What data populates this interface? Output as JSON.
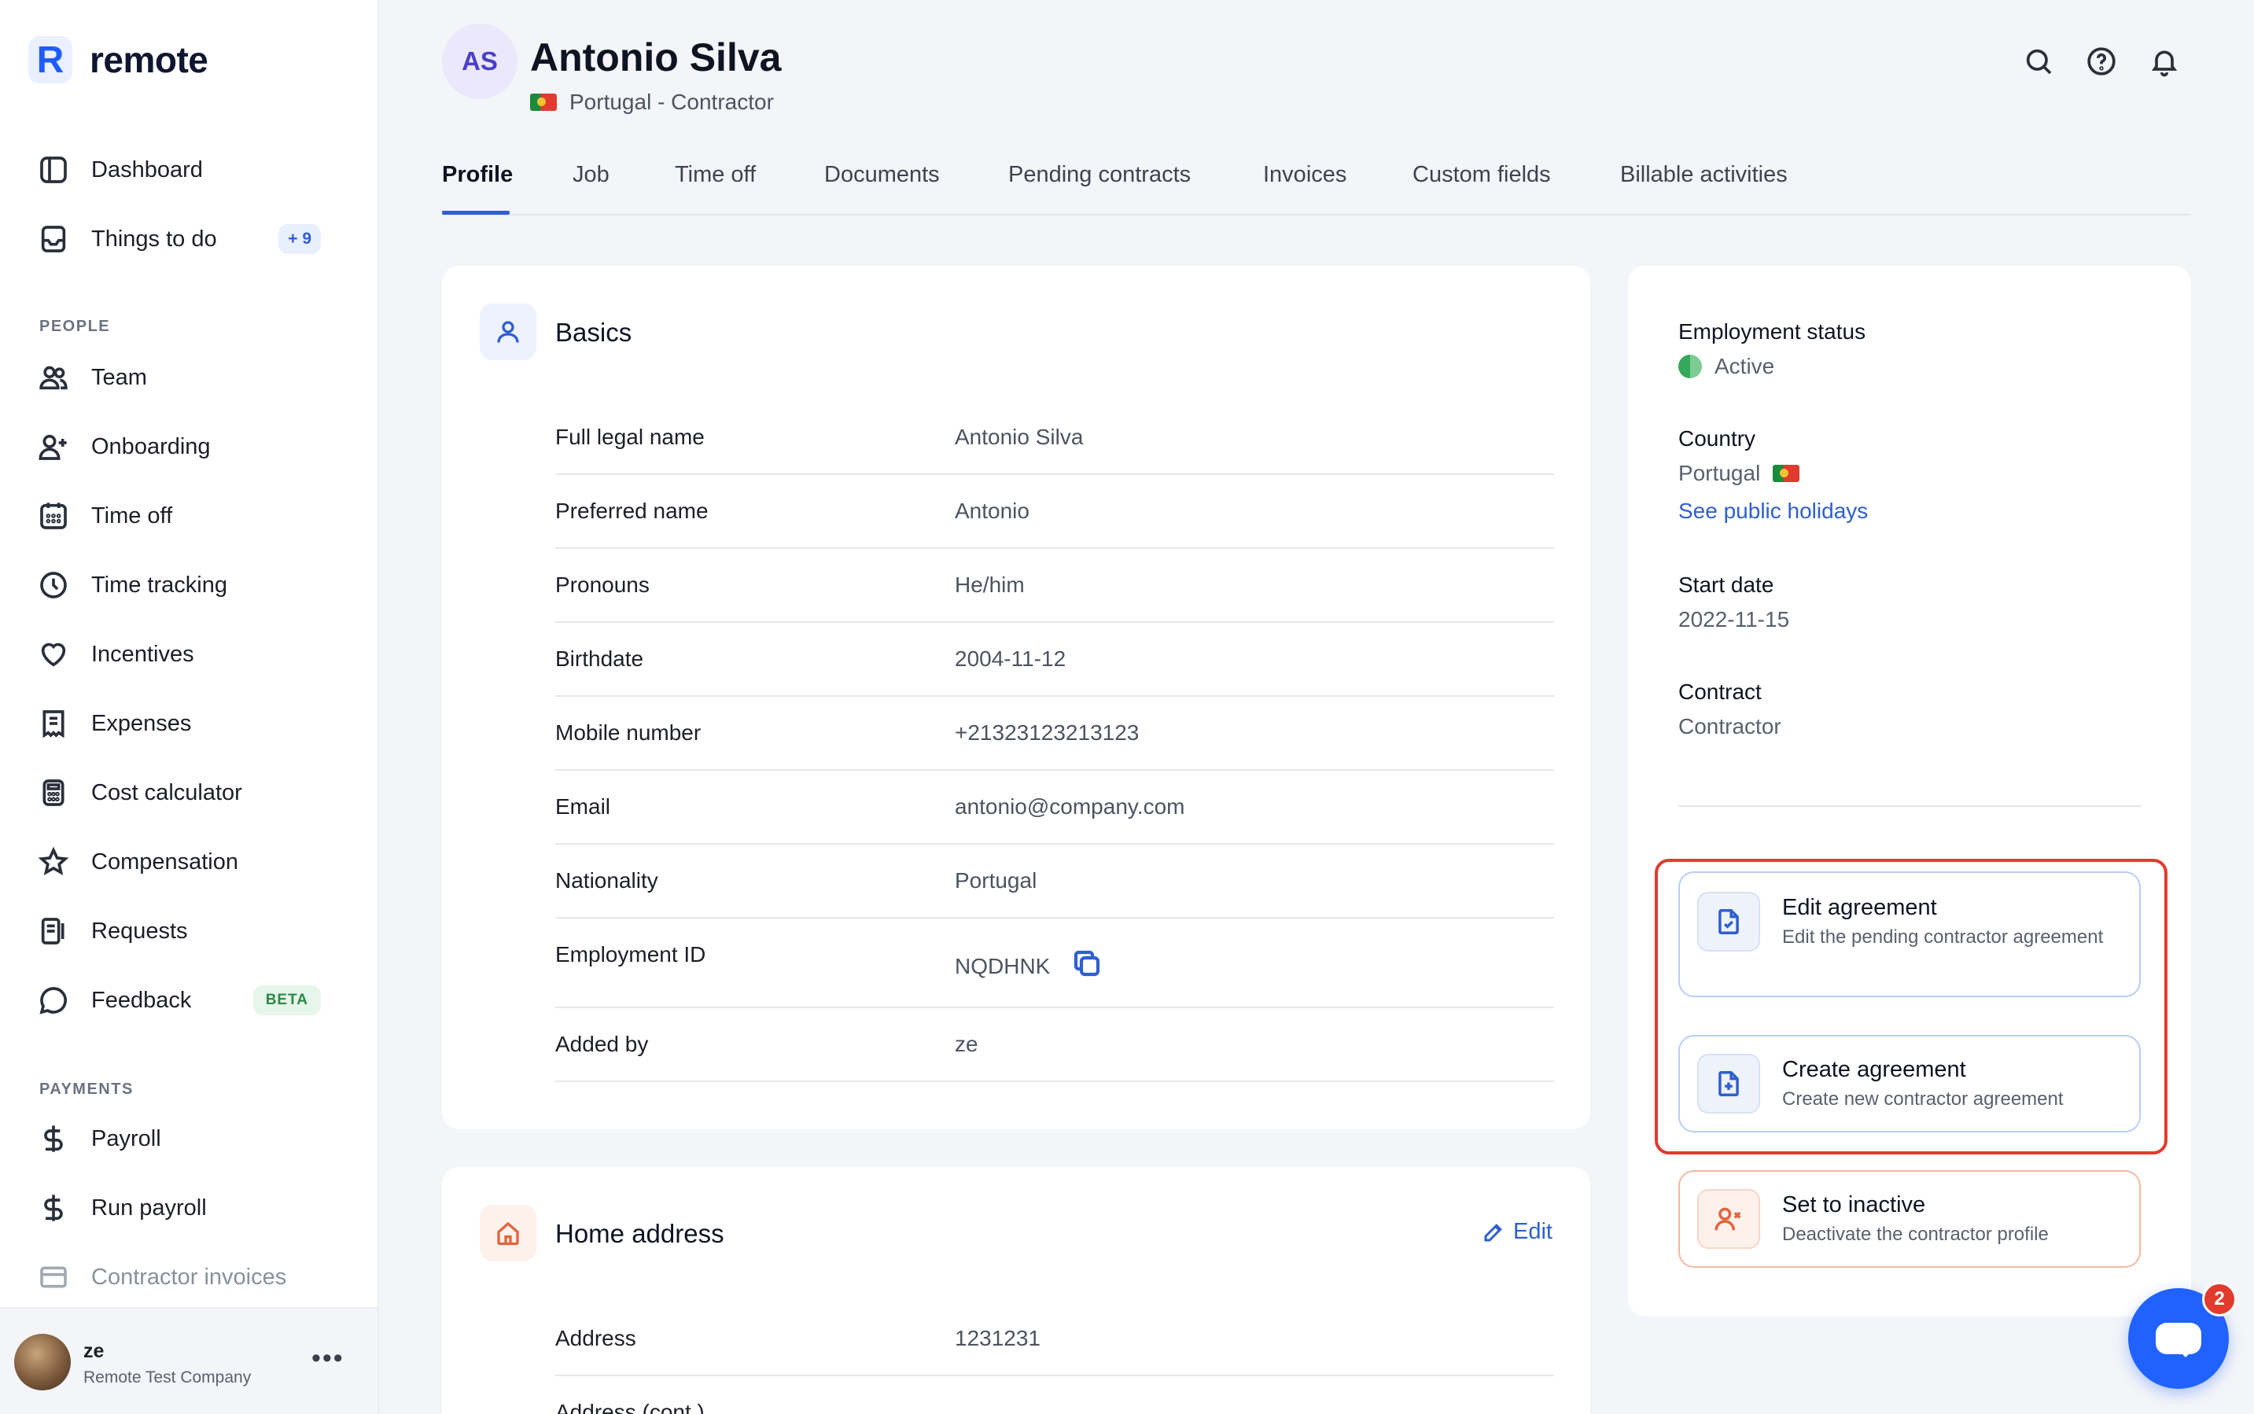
{
  "app": {
    "logo_letter": "R",
    "logo_text": "remote"
  },
  "sidebar": {
    "items": [
      {
        "label": "Dashboard",
        "icon": "sidebar-panel-icon"
      },
      {
        "label": "Things to do",
        "icon": "inbox-icon",
        "badge": "+ 9"
      }
    ],
    "people_label": "PEOPLE",
    "people": [
      {
        "label": "Team",
        "icon": "users-icon"
      },
      {
        "label": "Onboarding",
        "icon": "user-plus-icon"
      },
      {
        "label": "Time off",
        "icon": "calendar-icon"
      },
      {
        "label": "Time tracking",
        "icon": "clock-icon"
      },
      {
        "label": "Incentives",
        "icon": "heart-icon"
      },
      {
        "label": "Expenses",
        "icon": "receipt-icon"
      },
      {
        "label": "Cost calculator",
        "icon": "calculator-icon"
      },
      {
        "label": "Compensation",
        "icon": "star-icon"
      },
      {
        "label": "Requests",
        "icon": "document-list-icon"
      },
      {
        "label": "Feedback",
        "icon": "chat-bubble-icon",
        "badge": "BETA"
      }
    ],
    "payments_label": "PAYMENTS",
    "payments": [
      {
        "label": "Payroll",
        "icon": "dollar-icon"
      },
      {
        "label": "Run payroll",
        "icon": "dollar-icon"
      },
      {
        "label": "Contractor invoices",
        "icon": "card-icon"
      }
    ],
    "user": {
      "name": "ze",
      "company": "Remote Test Company",
      "more": "•••"
    }
  },
  "header": {
    "initials": "AS",
    "name": "Antonio Silva",
    "subtitle": "Portugal - Contractor"
  },
  "tabs": [
    "Profile",
    "Job",
    "Time off",
    "Documents",
    "Pending contracts",
    "Invoices",
    "Custom fields",
    "Billable activities"
  ],
  "basics": {
    "title": "Basics",
    "rows": [
      {
        "label": "Full legal name",
        "value": "Antonio Silva"
      },
      {
        "label": "Preferred name",
        "value": "Antonio"
      },
      {
        "label": "Pronouns",
        "value": "He/him"
      },
      {
        "label": "Birthdate",
        "value": "2004-11-12"
      },
      {
        "label": "Mobile number",
        "value": "+21323123213123"
      },
      {
        "label": "Email",
        "value": "antonio@company.com"
      },
      {
        "label": "Nationality",
        "value": "Portugal"
      },
      {
        "label": "Employment ID",
        "value": "NQDHNK"
      },
      {
        "label": "Added by",
        "value": "ze"
      }
    ]
  },
  "home_address": {
    "title": "Home address",
    "edit_label": "Edit",
    "rows": [
      {
        "label": "Address",
        "value": "1231231"
      },
      {
        "label": "Address (cont.)",
        "value": ""
      }
    ]
  },
  "status_panel": {
    "employment_status_label": "Employment status",
    "employment_status_value": "Active",
    "country_label": "Country",
    "country_value": "Portugal",
    "holidays_link": "See public holidays",
    "start_date_label": "Start date",
    "start_date_value": "2022-11-15",
    "contract_label": "Contract",
    "contract_value": "Contractor"
  },
  "actions": [
    {
      "title": "Edit agreement",
      "desc": "Edit the pending contractor agreement"
    },
    {
      "title": "Create agreement",
      "desc": "Create new contractor agreement"
    },
    {
      "title": "Set to inactive",
      "desc": "Deactivate the contractor profile"
    }
  ],
  "chat": {
    "count": "2"
  },
  "colors": {
    "accent": "#2f5fd0",
    "highlight": "#e23b2e",
    "danger": "#e2643c"
  }
}
